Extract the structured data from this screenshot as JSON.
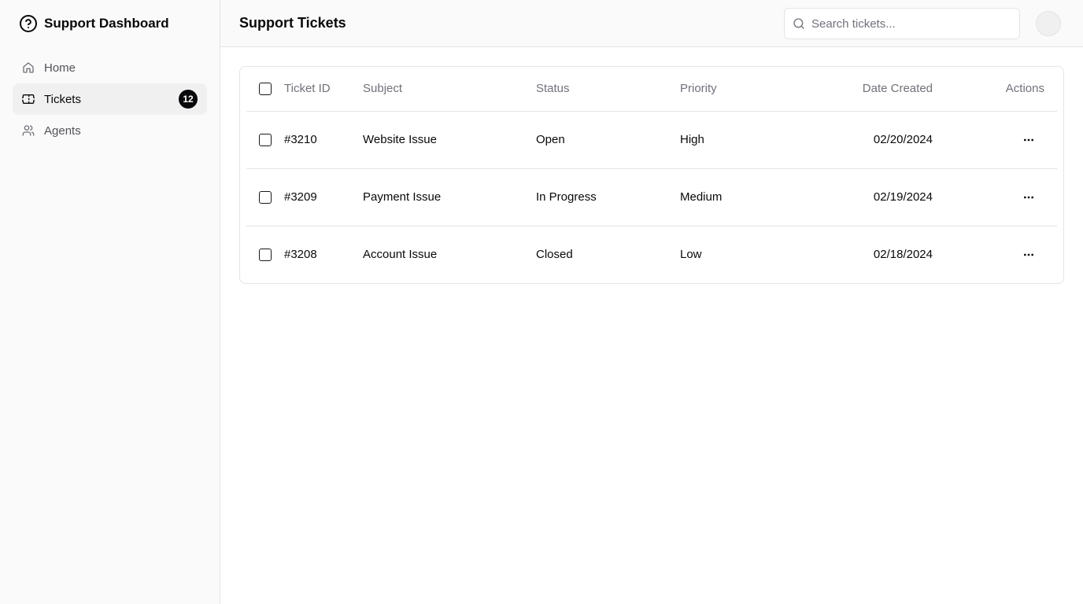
{
  "sidebar": {
    "brand": "Support Dashboard",
    "items": [
      {
        "label": "Home",
        "icon": "home-icon",
        "active": false
      },
      {
        "label": "Tickets",
        "icon": "ticket-icon",
        "active": true,
        "badge": "12"
      },
      {
        "label": "Agents",
        "icon": "users-icon",
        "active": false
      }
    ]
  },
  "header": {
    "title": "Support Tickets",
    "search_placeholder": "Search tickets...",
    "search_value": ""
  },
  "table": {
    "columns": [
      "Ticket ID",
      "Subject",
      "Status",
      "Priority",
      "Date Created",
      "Actions"
    ],
    "rows": [
      {
        "id": "#3210",
        "subject": "Website Issue",
        "status": "Open",
        "priority": "High",
        "date": "02/20/2024"
      },
      {
        "id": "#3209",
        "subject": "Payment Issue",
        "status": "In Progress",
        "priority": "Medium",
        "date": "02/19/2024"
      },
      {
        "id": "#3208",
        "subject": "Account Issue",
        "status": "Closed",
        "priority": "Low",
        "date": "02/18/2024"
      }
    ]
  },
  "colors": {
    "accent": "#09090b",
    "muted_text": "#71717a",
    "border": "#e4e4e7",
    "sidebar_bg": "#fafafa",
    "active_bg": "#f0f0f1"
  }
}
